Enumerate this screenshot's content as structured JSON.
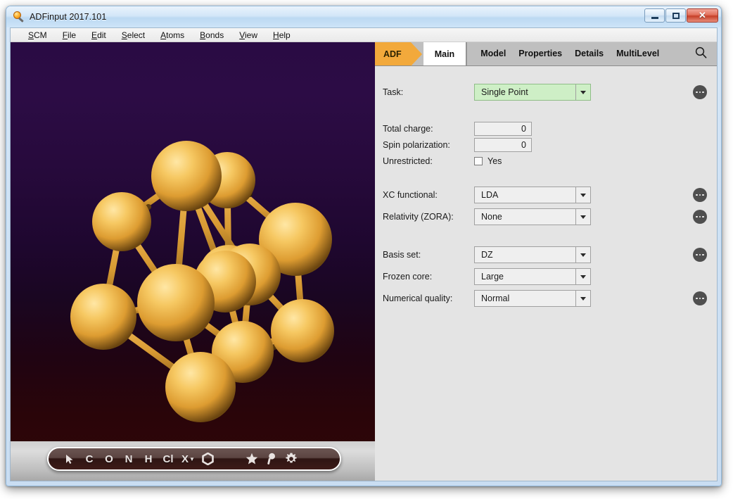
{
  "window": {
    "title": "ADFinput 2017.101",
    "icon": "magnifier-icon",
    "buttons": {
      "minimize": "minimize-icon",
      "maximize": "maximize-icon",
      "close": "✕"
    }
  },
  "menubar": {
    "items": [
      {
        "label": "SCM",
        "accel": "S"
      },
      {
        "label": "File",
        "accel": "F"
      },
      {
        "label": "Edit",
        "accel": "E"
      },
      {
        "label": "Select",
        "accel": "S"
      },
      {
        "label": "Atoms",
        "accel": "A"
      },
      {
        "label": "Bonds",
        "accel": "B"
      },
      {
        "label": "View",
        "accel": "V"
      },
      {
        "label": "Help",
        "accel": "H"
      }
    ]
  },
  "viewer": {
    "background_top": "#2a0b44",
    "background_bottom": "#310608",
    "atom_color": "#e8a93c",
    "bond_color": "#d89a33",
    "atom_toolbar": {
      "items": [
        {
          "name": "select-cursor-tool",
          "label": ""
        },
        {
          "name": "atom-c-tool",
          "label": "C"
        },
        {
          "name": "atom-o-tool",
          "label": "O"
        },
        {
          "name": "atom-n-tool",
          "label": "N"
        },
        {
          "name": "atom-h-tool",
          "label": "H"
        },
        {
          "name": "atom-cl-tool",
          "label": "Cl"
        },
        {
          "name": "atom-x-tool",
          "label": "X"
        },
        {
          "name": "benzene-ring-tool",
          "label": ""
        },
        {
          "name": "favorite-star-tool",
          "label": ""
        },
        {
          "name": "magnifier-tool",
          "label": ""
        },
        {
          "name": "settings-gear-tool",
          "label": ""
        }
      ]
    }
  },
  "panel": {
    "badge": "ADF",
    "tabs": [
      {
        "label": "Main",
        "active": true
      },
      {
        "label": "Model",
        "active": false
      },
      {
        "label": "Properties",
        "active": false
      },
      {
        "label": "Details",
        "active": false
      },
      {
        "label": "MultiLevel",
        "active": false
      }
    ],
    "search_icon": "search-icon",
    "accent_color": "#f2a93b",
    "fields": {
      "task": {
        "label": "Task:",
        "value": "Single Point",
        "type": "combo",
        "highlight": true,
        "has_help": true
      },
      "total_charge": {
        "label": "Total charge:",
        "value": "0",
        "type": "text",
        "has_help": false
      },
      "spin_polarization": {
        "label": "Spin polarization:",
        "value": "0",
        "type": "text",
        "has_help": false
      },
      "unrestricted": {
        "label": "Unrestricted:",
        "value": "Yes",
        "type": "checkbox",
        "checked": false,
        "has_help": false
      },
      "xc_functional": {
        "label": "XC functional:",
        "value": "LDA",
        "type": "combo",
        "highlight": false,
        "has_help": true
      },
      "relativity": {
        "label": "Relativity (ZORA):",
        "value": "None",
        "type": "combo",
        "highlight": false,
        "has_help": true
      },
      "basis_set": {
        "label": "Basis set:",
        "value": "DZ",
        "type": "combo",
        "highlight": false,
        "has_help": true
      },
      "frozen_core": {
        "label": "Frozen core:",
        "value": "Large",
        "type": "combo",
        "highlight": false,
        "has_help": false
      },
      "numerical_quality": {
        "label": "Numerical quality:",
        "value": "Normal",
        "type": "combo",
        "highlight": false,
        "has_help": true
      }
    }
  }
}
